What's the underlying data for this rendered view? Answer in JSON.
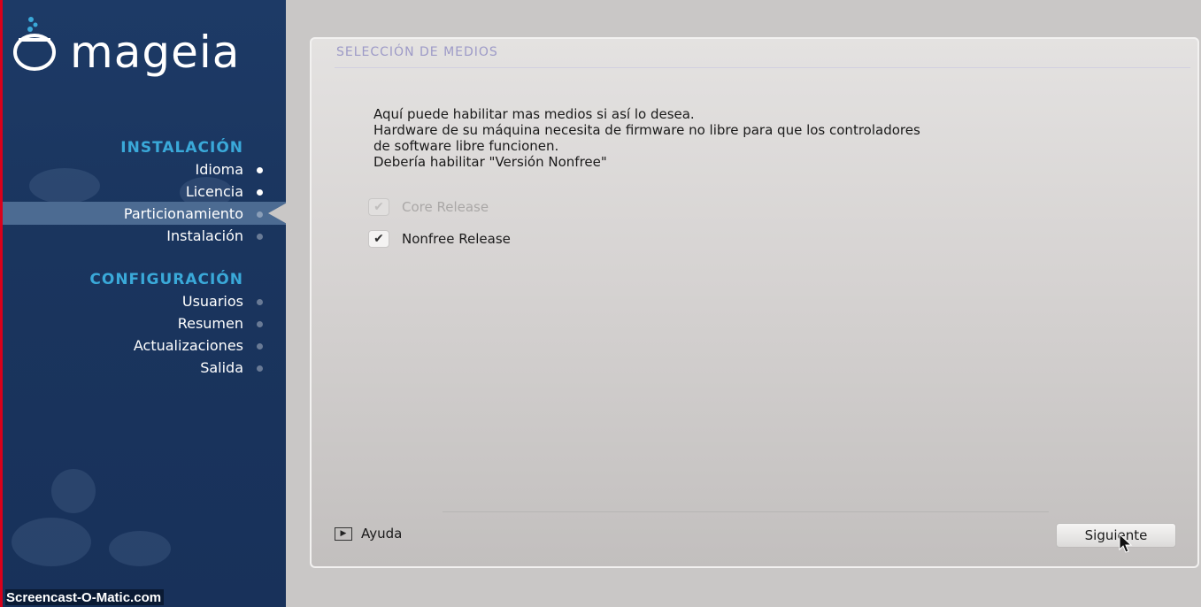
{
  "brand": {
    "name": "mageia"
  },
  "sidebar": {
    "sections": [
      {
        "title": "INSTALACIÓN",
        "items": [
          {
            "label": "Idioma",
            "state": "done"
          },
          {
            "label": "Licencia",
            "state": "done"
          },
          {
            "label": "Particionamiento",
            "state": "active"
          },
          {
            "label": "Instalación",
            "state": "pending"
          }
        ]
      },
      {
        "title": "CONFIGURACIÓN",
        "items": [
          {
            "label": "Usuarios",
            "state": "pending"
          },
          {
            "label": "Resumen",
            "state": "pending"
          },
          {
            "label": "Actualizaciones",
            "state": "pending"
          },
          {
            "label": "Salida",
            "state": "pending"
          }
        ]
      }
    ]
  },
  "watermark": "Screencast-O-Matic.com",
  "panel": {
    "title": "SELECCIÓN DE MEDIOS",
    "description": "Aquí puede habilitar mas medios si así lo desea.\nHardware de su máquina necesita de firmware no libre para que los controladores\nde software libre funcionen.\nDebería habilitar \"Versión Nonfree\"",
    "options": [
      {
        "label": "Core Release",
        "checked": true,
        "disabled": true
      },
      {
        "label": "Nonfree Release",
        "checked": true,
        "disabled": false
      }
    ],
    "help_label": "Ayuda",
    "next_label": "Siguiente"
  },
  "colors": {
    "sidebar_bg": "#1d3a66",
    "section_title": "#3aa9d9",
    "active_bar": "#4c6b92",
    "panel_title": "#9d9ac7"
  }
}
